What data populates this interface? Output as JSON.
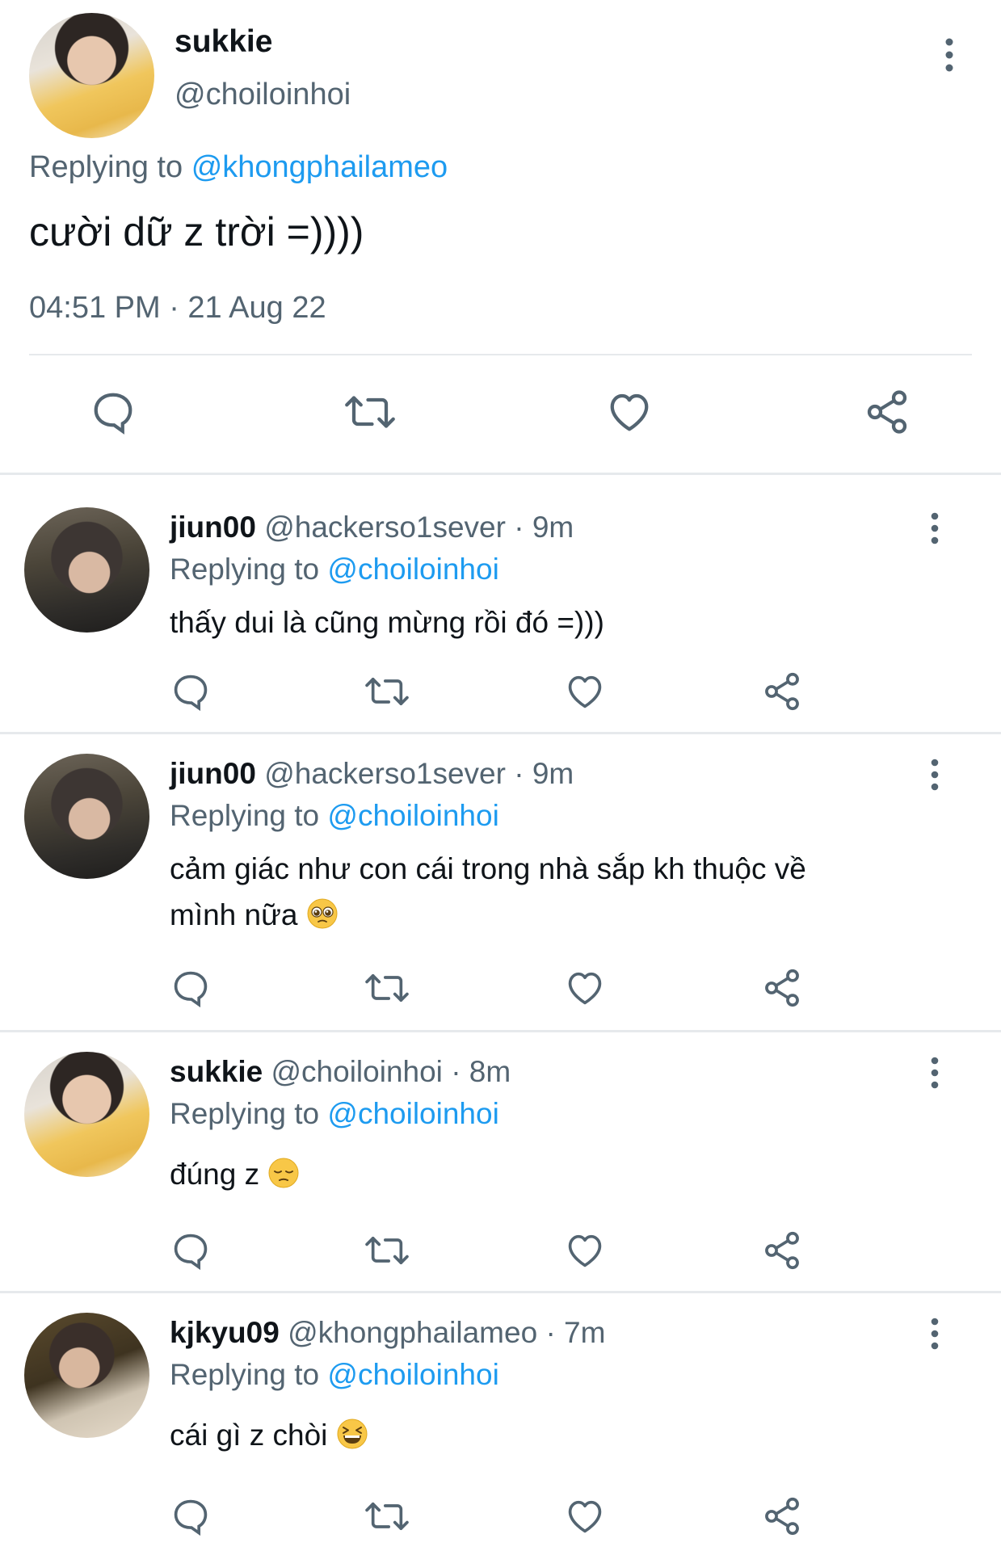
{
  "main_tweet": {
    "display_name": "sukkie",
    "handle": "@choiloinhoi",
    "replying_prefix": "Replying to",
    "replying_to": "@khongphailameo",
    "text": "cười dữ z trời =))))",
    "timestamp": "04:51 PM · 21 Aug 22",
    "actions": [
      "reply-icon",
      "retweet-icon",
      "like-icon",
      "share-icon"
    ]
  },
  "replies": [
    {
      "display_name": "jiun00",
      "handle": "@hackerso1sever",
      "time": "· 9m",
      "replying_prefix": "Replying to",
      "replying_to": "@choiloinhoi",
      "text_line1": "thấy dui là cũng mừng rồi đó =)))",
      "text_line2": ""
    },
    {
      "display_name": "jiun00",
      "handle": "@hackerso1sever",
      "time": "· 9m",
      "replying_prefix": "Replying to",
      "replying_to": "@choiloinhoi",
      "text_line1": "cảm giác như con cái trong nhà sắp kh thuộc về",
      "text_line2": "mình nữa",
      "emoji": "pleading-face-emoji"
    },
    {
      "display_name": "sukkie",
      "handle": "@choiloinhoi",
      "time": "· 8m",
      "replying_prefix": "Replying to",
      "replying_to": "@choiloinhoi",
      "text_line1": "đúng z",
      "emoji": "pensive-face-emoji"
    },
    {
      "display_name": "kjkyu09",
      "handle": "@khongphailameo",
      "time": "· 7m",
      "replying_prefix": "Replying to",
      "replying_to": "@choiloinhoi",
      "text_line1": "cái gì z chòi",
      "emoji": "grinning-squinting-face-emoji"
    }
  ],
  "colors": {
    "link": "#1d9bf0",
    "muted": "#536471",
    "text": "#0f1419",
    "divider": "#e6e9ec"
  }
}
